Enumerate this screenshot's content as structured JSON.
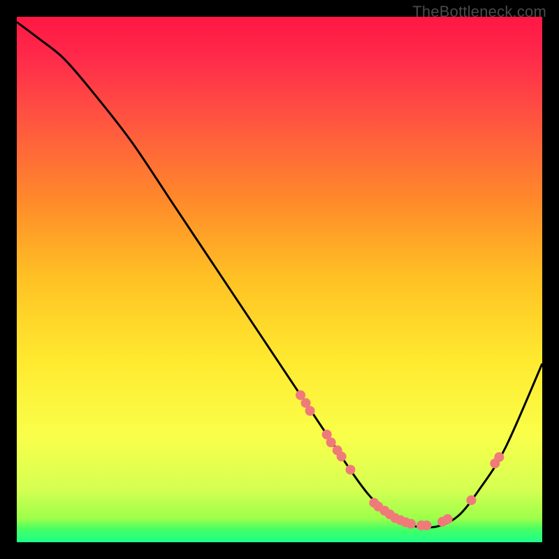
{
  "watermark": "TheBottleneck.com",
  "chart_data": {
    "type": "line",
    "title": "",
    "xlabel": "",
    "ylabel": "",
    "xlim": [
      0,
      100
    ],
    "ylim": [
      0,
      100
    ],
    "grid": false,
    "legend": false,
    "gradient_stops": [
      {
        "offset": 0.0,
        "color": "#ff1744"
      },
      {
        "offset": 0.08,
        "color": "#ff2b4a"
      },
      {
        "offset": 0.2,
        "color": "#ff5640"
      },
      {
        "offset": 0.35,
        "color": "#ff8a2a"
      },
      {
        "offset": 0.5,
        "color": "#ffc224"
      },
      {
        "offset": 0.65,
        "color": "#ffe92f"
      },
      {
        "offset": 0.8,
        "color": "#f9ff4a"
      },
      {
        "offset": 0.9,
        "color": "#d4ff52"
      },
      {
        "offset": 0.955,
        "color": "#9dff4a"
      },
      {
        "offset": 0.975,
        "color": "#47ff64"
      },
      {
        "offset": 1.0,
        "color": "#1bff88"
      }
    ],
    "series": [
      {
        "name": "bottleneck-curve",
        "x": [
          0,
          4,
          9,
          15,
          22,
          30,
          38,
          46,
          54,
          60,
          64,
          67,
          70,
          73,
          76,
          80,
          84,
          88,
          93,
          100
        ],
        "y": [
          99,
          96,
          92,
          85,
          76,
          64,
          52,
          40,
          28,
          19,
          13,
          9,
          6,
          4,
          3,
          3,
          5,
          10,
          18,
          34
        ]
      }
    ],
    "markers": {
      "color": "#f07a7a",
      "radius": 7,
      "points": [
        {
          "x": 54.0,
          "y": 28.0
        },
        {
          "x": 55.0,
          "y": 26.5
        },
        {
          "x": 55.8,
          "y": 25.0
        },
        {
          "x": 59.0,
          "y": 20.5
        },
        {
          "x": 59.8,
          "y": 19.0
        },
        {
          "x": 61.0,
          "y": 17.5
        },
        {
          "x": 61.8,
          "y": 16.3
        },
        {
          "x": 63.5,
          "y": 13.8
        },
        {
          "x": 68.0,
          "y": 7.5
        },
        {
          "x": 68.8,
          "y": 6.8
        },
        {
          "x": 70.0,
          "y": 6.0
        },
        {
          "x": 71.0,
          "y": 5.3
        },
        {
          "x": 72.0,
          "y": 4.6
        },
        {
          "x": 73.0,
          "y": 4.2
        },
        {
          "x": 74.0,
          "y": 3.8
        },
        {
          "x": 75.0,
          "y": 3.5
        },
        {
          "x": 77.0,
          "y": 3.2
        },
        {
          "x": 78.0,
          "y": 3.2
        },
        {
          "x": 81.0,
          "y": 3.9
        },
        {
          "x": 82.0,
          "y": 4.4
        },
        {
          "x": 86.5,
          "y": 8.0
        },
        {
          "x": 91.0,
          "y": 15.0
        },
        {
          "x": 91.8,
          "y": 16.2
        }
      ]
    }
  }
}
